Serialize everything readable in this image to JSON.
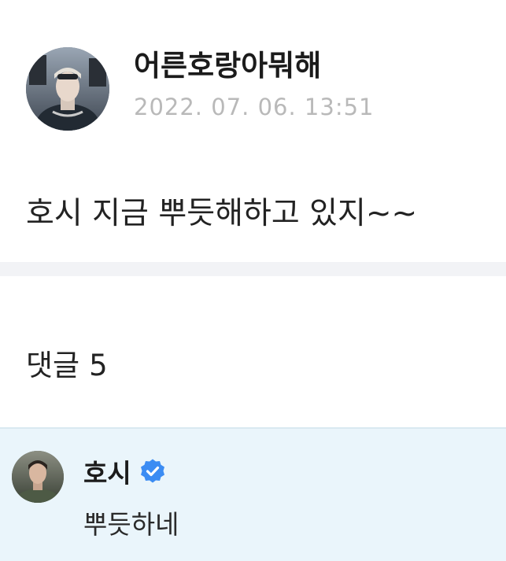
{
  "post": {
    "author_name": "어른호랑아뭐해",
    "date": "2022. 07. 06. 13:51",
    "body": "호시 지금 뿌듯해하고 있지~~"
  },
  "comments": {
    "label": "댓글",
    "count": "5"
  },
  "reply": {
    "author_name": "호시",
    "text": "뿌듯하네",
    "verified_icon": "verified-badge-icon",
    "verified_color": "#3b8cf3"
  },
  "colors": {
    "reply_background": "#eaf5fb",
    "divider_band": "#f2f3f6",
    "date_text": "#b9b9b9"
  }
}
